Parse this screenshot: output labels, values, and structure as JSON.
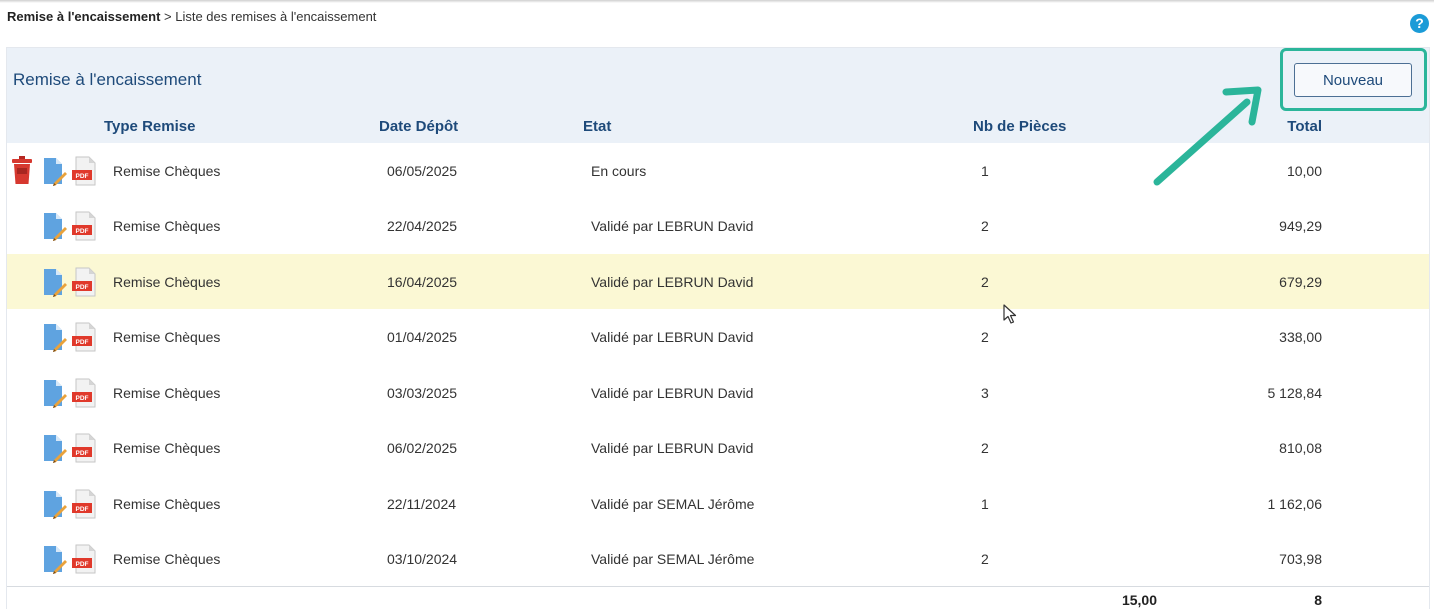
{
  "breadcrumb": {
    "root": "Remise à l'encaissement",
    "separator": " > ",
    "current": "Liste des remises à l'encaissement"
  },
  "help_label": "?",
  "panel": {
    "title": "Remise à l'encaissement",
    "new_button": "Nouveau"
  },
  "columns": {
    "type": "Type Remise",
    "date": "Date Dépôt",
    "etat": "Etat",
    "nb": "Nb de Pièces",
    "total": "Total"
  },
  "rows": [
    {
      "type": "Remise Chèques",
      "date": "06/05/2025",
      "etat": "En cours",
      "nb": "1",
      "total": "10,00",
      "deletable": true,
      "highlighted": false
    },
    {
      "type": "Remise Chèques",
      "date": "22/04/2025",
      "etat": "Validé par LEBRUN David",
      "nb": "2",
      "total": "949,29",
      "deletable": false,
      "highlighted": false
    },
    {
      "type": "Remise Chèques",
      "date": "16/04/2025",
      "etat": "Validé par LEBRUN David",
      "nb": "2",
      "total": "679,29",
      "deletable": false,
      "highlighted": true
    },
    {
      "type": "Remise Chèques",
      "date": "01/04/2025",
      "etat": "Validé par LEBRUN David",
      "nb": "2",
      "total": "338,00",
      "deletable": false,
      "highlighted": false
    },
    {
      "type": "Remise Chèques",
      "date": "03/03/2025",
      "etat": "Validé par LEBRUN David",
      "nb": "3",
      "total": "5 128,84",
      "deletable": false,
      "highlighted": false
    },
    {
      "type": "Remise Chèques",
      "date": "06/02/2025",
      "etat": "Validé par LEBRUN David",
      "nb": "2",
      "total": "810,08",
      "deletable": false,
      "highlighted": false
    },
    {
      "type": "Remise Chèques",
      "date": "22/11/2024",
      "etat": "Validé par SEMAL Jérôme",
      "nb": "1",
      "total": "1 162,06",
      "deletable": false,
      "highlighted": false
    },
    {
      "type": "Remise Chèques",
      "date": "03/10/2024",
      "etat": "Validé par SEMAL Jérôme",
      "nb": "2",
      "total": "703,98",
      "deletable": false,
      "highlighted": false
    }
  ],
  "totals": {
    "amount": "15,00",
    "count": "8"
  },
  "icons": {
    "delete": "trash-icon",
    "edit": "edit-document-icon",
    "pdf": "pdf-icon"
  },
  "colors": {
    "accent": "#1e4a7a",
    "highlight_row": "#fbf8d4",
    "annotation": "#2bb59a",
    "header_bg": "#ebf1f8"
  }
}
